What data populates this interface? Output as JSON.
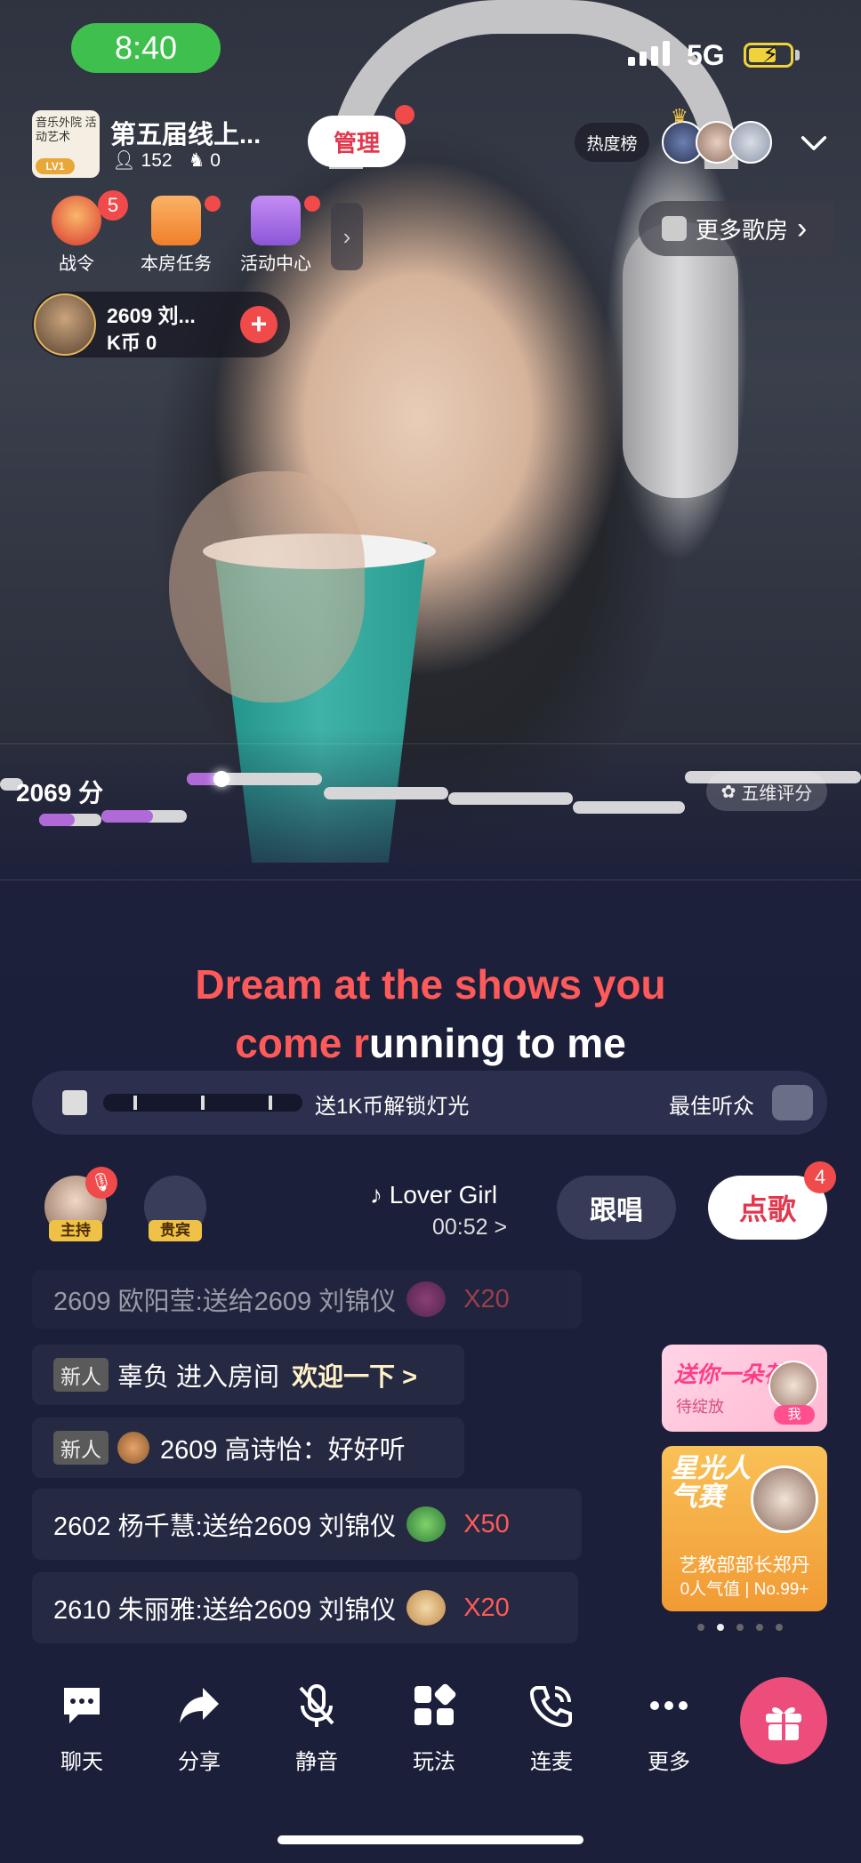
{
  "status_bar": {
    "time": "8:40",
    "network": "5G"
  },
  "room": {
    "title": "第五届线上...",
    "logo_text": "音乐外院 活动艺术",
    "level": "LV1",
    "members": "152",
    "mics": "0",
    "manage_label": "管理",
    "hot_label": "热度榜"
  },
  "activities": [
    {
      "label": "战令",
      "badge": "5"
    },
    {
      "label": "本房任务"
    },
    {
      "label": "活动中心"
    }
  ],
  "more_rooms_label": "更多歌房",
  "singer": {
    "name": "2609 刘...",
    "coins": "K币 0"
  },
  "pitch": {
    "score": "2069 分",
    "rate_label": "五维评分"
  },
  "lyrics": {
    "line1_sung": "Dream at the shows you",
    "line1_rest": "",
    "line2_sung": "come r",
    "line2_rest": "unning to me"
  },
  "giftbar": {
    "unlock_label": "送1K币解锁灯光",
    "best_label": "最佳听众"
  },
  "seats": {
    "host_tag": "主持",
    "guest_tag": "贵宾"
  },
  "song": {
    "title": "Lover Girl",
    "time": "00:52 >"
  },
  "buttons": {
    "sing_label": "跟唱",
    "order_label": "点歌",
    "order_badge": "4"
  },
  "chat": [
    {
      "text": "2609 欧阳莹:送给2609 刘锦仪",
      "count": "X20"
    },
    {
      "tag": "新人",
      "text": "辜负 进入房间",
      "action": "欢迎一下 >"
    },
    {
      "tag": "新人",
      "text": "2609 高诗怡：好好听"
    },
    {
      "text": "2602 杨千慧:送给2609 刘锦仪",
      "count": "X50"
    },
    {
      "text": "2610 朱丽雅:送给2609 刘锦仪",
      "count": "X20"
    }
  ],
  "cards": {
    "flower_title": "送你一朵花",
    "flower_sub": "待绽放",
    "flower_me": "我",
    "star_title": "星光人气赛",
    "star_name": "艺教部部长郑丹",
    "star_stats": "0人气值 | No.99+"
  },
  "nav": [
    {
      "label": "聊天",
      "icon": "chat-icon"
    },
    {
      "label": "分享",
      "icon": "share-icon"
    },
    {
      "label": "静音",
      "icon": "mute-icon"
    },
    {
      "label": "玩法",
      "icon": "grid-icon"
    },
    {
      "label": "连麦",
      "icon": "phone-icon"
    },
    {
      "label": "更多",
      "icon": "more-icon"
    }
  ],
  "colors": {
    "accent": "#e2384e",
    "lyric_sung": "#ff5a5a",
    "background": "#1c1f3a"
  }
}
